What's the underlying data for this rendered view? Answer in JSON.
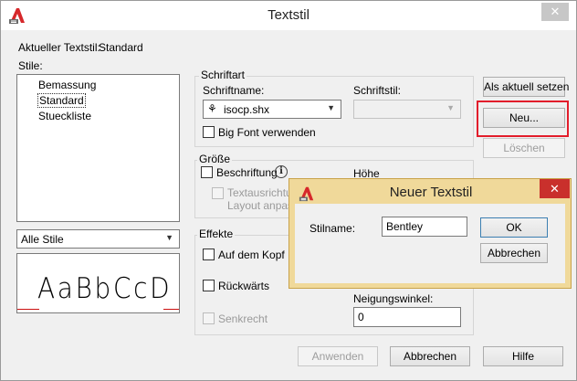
{
  "window": {
    "title": "Textstil",
    "close_glyph": "✕"
  },
  "current_style": {
    "label": "Aktueller Textstil:",
    "value": "Standard"
  },
  "styles": {
    "label": "Stile:",
    "items": [
      "Bemassung",
      "Standard",
      "Stueckliste"
    ],
    "selected": "Standard",
    "filter_value": "Alle Stile"
  },
  "preview": {
    "text": "AaBbCcD"
  },
  "font": {
    "group_title": "Schriftart",
    "name_label": "Schriftname:",
    "name_value": "isocp.shx",
    "style_label": "Schriftstil:",
    "style_value": "",
    "bigfont_label": "Big Font verwenden"
  },
  "size": {
    "group_title": "Größe",
    "annotative_label": "Beschriftung",
    "annotative_info_glyph": "i",
    "height_label": "Höhe",
    "match_orientation_label_1": "Textausrichtun",
    "match_orientation_label_2": "Layout anpass"
  },
  "effects": {
    "group_title": "Effekte",
    "upside_down_label": "Auf dem Kopf",
    "backwards_label": "Rückwärts",
    "vertical_label": "Senkrecht",
    "oblique_label": "Neigungswinkel:",
    "oblique_value": "0"
  },
  "side_buttons": {
    "set_current": "Als aktuell setzen",
    "new": "Neu...",
    "delete": "Löschen"
  },
  "bottom_buttons": {
    "apply": "Anwenden",
    "cancel": "Abbrechen",
    "help": "Hilfe"
  },
  "new_style_dialog": {
    "title": "Neuer Textstil",
    "close_glyph": "✕",
    "name_label": "Stilname:",
    "name_value": "Bentley",
    "ok": "OK",
    "cancel": "Abbrechen"
  },
  "colors": {
    "highlight": "#e21d2b",
    "modal_frame": "#f0d99a",
    "modal_close": "#c9302c",
    "logo_red": "#d6282b"
  },
  "icons": {
    "app": "autocad-logo-icon",
    "font_type": "shx-font-icon",
    "info": "info-icon",
    "dropdown": "chevron-down-icon"
  }
}
